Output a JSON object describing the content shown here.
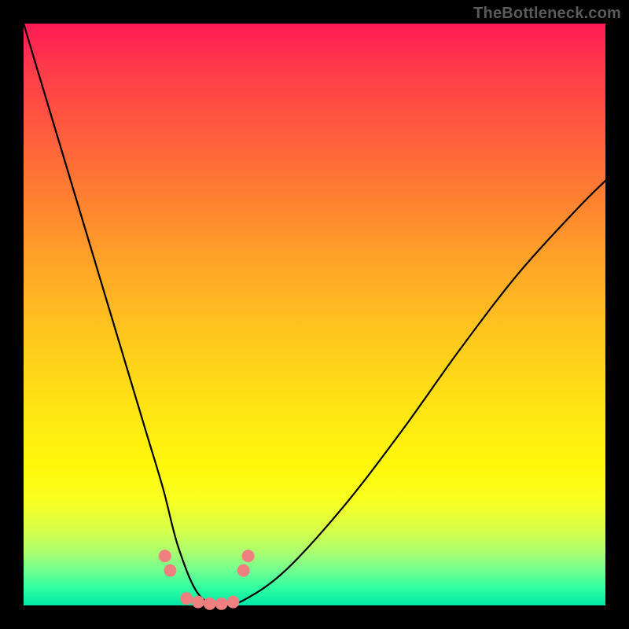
{
  "watermark": "TheBottleneck.com",
  "chart_data": {
    "type": "line",
    "title": "",
    "xlabel": "",
    "ylabel": "",
    "xlim": [
      0,
      1
    ],
    "ylim": [
      0,
      1
    ],
    "background_gradient": {
      "top": "#ff1a55",
      "mid": "#fff80a",
      "bottom": "#00e8a8"
    },
    "series": [
      {
        "name": "curve",
        "color": "#000000",
        "x": [
          0.0,
          0.03,
          0.06,
          0.09,
          0.12,
          0.15,
          0.18,
          0.21,
          0.24,
          0.266,
          0.3,
          0.34,
          0.38,
          0.45,
          0.55,
          0.65,
          0.75,
          0.85,
          0.95,
          1.0
        ],
        "values": [
          1.0,
          0.9,
          0.8,
          0.7,
          0.6,
          0.5,
          0.4,
          0.3,
          0.2,
          0.1,
          0.02,
          0.0,
          0.01,
          0.06,
          0.17,
          0.3,
          0.44,
          0.57,
          0.68,
          0.73
        ]
      }
    ],
    "markers": {
      "color": "#f08080",
      "radius_outer": 8,
      "radius_inner": 6,
      "points": [
        {
          "x": 0.243,
          "y": 0.085
        },
        {
          "x": 0.252,
          "y": 0.06
        },
        {
          "x": 0.28,
          "y": 0.012
        },
        {
          "x": 0.3,
          "y": 0.006
        },
        {
          "x": 0.32,
          "y": 0.003
        },
        {
          "x": 0.34,
          "y": 0.003
        },
        {
          "x": 0.36,
          "y": 0.006
        },
        {
          "x": 0.378,
          "y": 0.06
        },
        {
          "x": 0.386,
          "y": 0.085
        }
      ]
    }
  }
}
